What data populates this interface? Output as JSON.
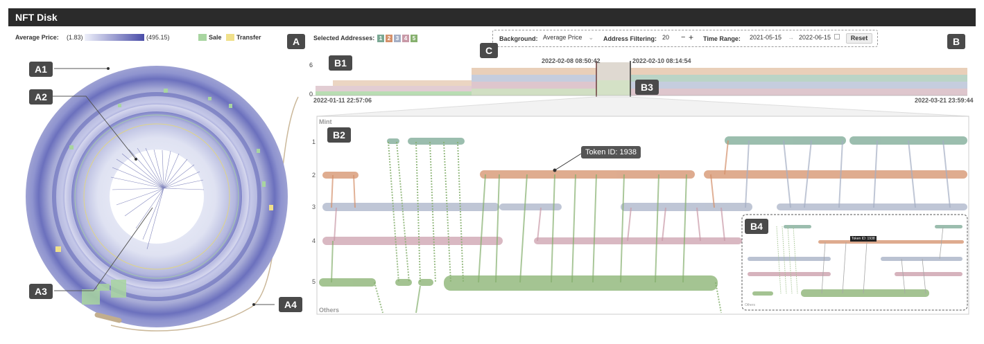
{
  "app": {
    "title": "NFT Disk"
  },
  "panel_tags": {
    "a": "A",
    "a1": "A1",
    "a2": "A2",
    "a3": "A3",
    "a4": "A4",
    "b": "B",
    "b1": "B1",
    "b2": "B2",
    "b3": "B3",
    "b4": "B4",
    "c": "C"
  },
  "legend": {
    "avg_price_label": "Average Price:",
    "min": "(1.83)",
    "max": "(495.15)",
    "sale": "Sale",
    "transfer": "Transfer",
    "sale_color": "#a8d5a0",
    "transfer_color": "#f0e08a"
  },
  "selected_addresses": {
    "label": "Selected Addresses:",
    "items": [
      "1",
      "2",
      "3",
      "4",
      "5"
    ],
    "colors": [
      "#7aa893",
      "#d4906a",
      "#a4aec4",
      "#c99aa8",
      "#86b06e"
    ]
  },
  "controls": {
    "background_label": "Background:",
    "background_value": "Average Price",
    "filter_label": "Address Filtering:",
    "filter_value": "20",
    "time_label": "Time Range:",
    "time_start": "2021-05-15",
    "time_end": "2022-06-15",
    "reset": "Reset"
  },
  "timeline": {
    "y_max": "6",
    "y_min": "0",
    "start": "2022-01-11 22:57:06",
    "end": "2022-03-21 23:59:44",
    "brush_start": "2022-02-08 08:50:42",
    "brush_end": "2022-02-10 08:14:54"
  },
  "storyline": {
    "top_label": "Mint",
    "bottom_label": "Others",
    "rows": [
      "1",
      "2",
      "3",
      "4",
      "5"
    ],
    "callout": "Token ID: 1938",
    "mini_callout": "Token ID: 1938",
    "mini_bottom": "Others"
  }
}
